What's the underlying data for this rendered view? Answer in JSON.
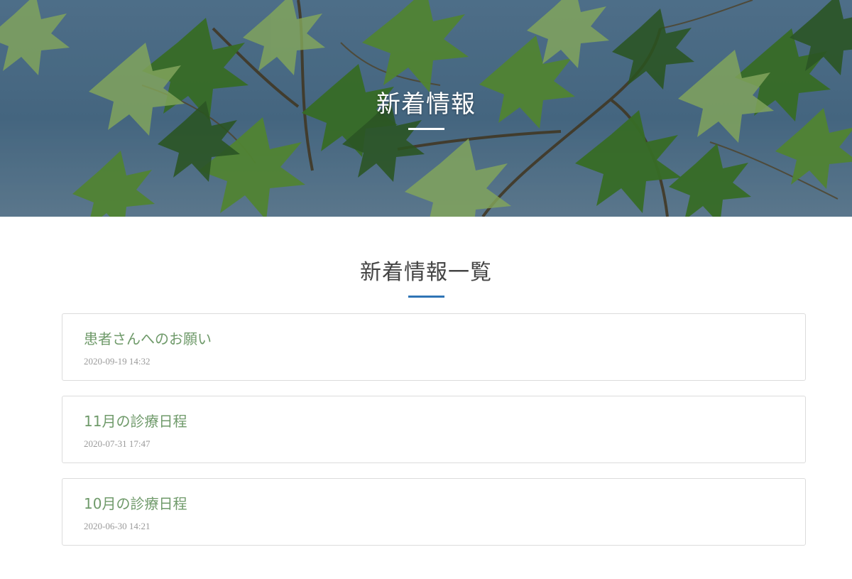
{
  "hero": {
    "title": "新着情報",
    "background": "green-maple-leaves-photo"
  },
  "section": {
    "title": "新着情報一覧",
    "accent_color": "#2f74b5"
  },
  "news": [
    {
      "title": "患者さんへのお願い",
      "date": "2020-09-19 14:32"
    },
    {
      "title": "11月の診療日程",
      "date": "2020-07-31 17:47"
    },
    {
      "title": "10月の診療日程",
      "date": "2020-06-30 14:21"
    }
  ],
  "colors": {
    "link": "#6f9a6a",
    "date": "#9a9a9a",
    "border": "#dcdcdc"
  }
}
